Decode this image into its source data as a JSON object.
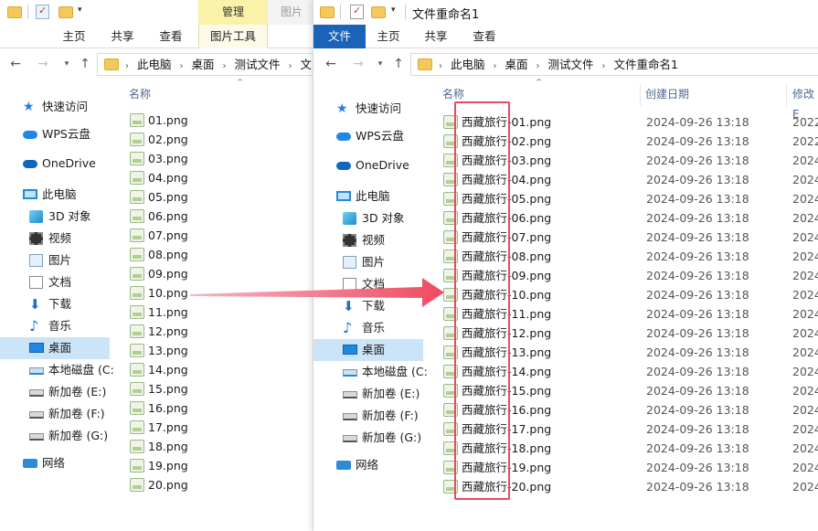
{
  "left_window": {
    "ribbon_context_header": "管理",
    "ribbon_context_header_2": "图片",
    "tabs": [
      "主页",
      "共享",
      "查看",
      "图片工具"
    ],
    "breadcrumbs": [
      "此电脑",
      "桌面",
      "测试文件",
      "文"
    ],
    "column_name": "名称",
    "files": [
      "01.png",
      "02.png",
      "03.png",
      "04.png",
      "05.png",
      "06.png",
      "07.png",
      "08.png",
      "09.png",
      "10.png",
      "11.png",
      "12.png",
      "13.png",
      "14.png",
      "15.png",
      "16.png",
      "17.png",
      "18.png",
      "19.png",
      "20.png"
    ]
  },
  "right_window": {
    "title": "文件重命名1",
    "tabs": [
      "文件",
      "主页",
      "共享",
      "查看"
    ],
    "breadcrumbs": [
      "此电脑",
      "桌面",
      "测试文件",
      "文件重命名1"
    ],
    "columns": {
      "name": "名称",
      "created": "创建日期",
      "modified": "修改E"
    },
    "files": [
      {
        "name": "西藏旅行-01.png",
        "created": "2024-09-26 13:18",
        "modified": "2022"
      },
      {
        "name": "西藏旅行-02.png",
        "created": "2024-09-26 13:18",
        "modified": "2022"
      },
      {
        "name": "西藏旅行-03.png",
        "created": "2024-09-26 13:18",
        "modified": "2024"
      },
      {
        "name": "西藏旅行-04.png",
        "created": "2024-09-26 13:18",
        "modified": "2024"
      },
      {
        "name": "西藏旅行-05.png",
        "created": "2024-09-26 13:18",
        "modified": "2024"
      },
      {
        "name": "西藏旅行-06.png",
        "created": "2024-09-26 13:18",
        "modified": "2024"
      },
      {
        "name": "西藏旅行-07.png",
        "created": "2024-09-26 13:18",
        "modified": "2024"
      },
      {
        "name": "西藏旅行-08.png",
        "created": "2024-09-26 13:18",
        "modified": "2024"
      },
      {
        "name": "西藏旅行-09.png",
        "created": "2024-09-26 13:18",
        "modified": "2024"
      },
      {
        "name": "西藏旅行-10.png",
        "created": "2024-09-26 13:18",
        "modified": "2024"
      },
      {
        "name": "西藏旅行-11.png",
        "created": "2024-09-26 13:18",
        "modified": "2024"
      },
      {
        "name": "西藏旅行-12.png",
        "created": "2024-09-26 13:18",
        "modified": "2024"
      },
      {
        "name": "西藏旅行-13.png",
        "created": "2024-09-26 13:18",
        "modified": "2024"
      },
      {
        "name": "西藏旅行-14.png",
        "created": "2024-09-26 13:18",
        "modified": "2024"
      },
      {
        "name": "西藏旅行-15.png",
        "created": "2024-09-26 13:18",
        "modified": "2024"
      },
      {
        "name": "西藏旅行-16.png",
        "created": "2024-09-26 13:18",
        "modified": "2024"
      },
      {
        "name": "西藏旅行-17.png",
        "created": "2024-09-26 13:18",
        "modified": "2024"
      },
      {
        "name": "西藏旅行-18.png",
        "created": "2024-09-26 13:18",
        "modified": "2024"
      },
      {
        "name": "西藏旅行-19.png",
        "created": "2024-09-26 13:18",
        "modified": "2024"
      },
      {
        "name": "西藏旅行-20.png",
        "created": "2024-09-26 13:18",
        "modified": "2024"
      }
    ]
  },
  "nav_pane": [
    {
      "label": "快速访问",
      "icon": "star-icon"
    },
    {
      "label": "WPS云盘",
      "icon": "cloud-icon"
    },
    {
      "label": "OneDrive",
      "icon": "onedrive-icon"
    },
    {
      "label": "此电脑",
      "icon": "computer-icon"
    },
    {
      "label": "3D 对象",
      "icon": "3d-objects-icon"
    },
    {
      "label": "视频",
      "icon": "video-icon"
    },
    {
      "label": "图片",
      "icon": "pictures-icon"
    },
    {
      "label": "文档",
      "icon": "documents-icon"
    },
    {
      "label": "下载",
      "icon": "download-icon"
    },
    {
      "label": "音乐",
      "icon": "music-icon"
    },
    {
      "label": "桌面",
      "icon": "desktop-icon",
      "selected": true
    },
    {
      "label": "本地磁盘 (C:",
      "icon": "system-drive-icon"
    },
    {
      "label": "新加卷 (E:)",
      "icon": "drive-icon"
    },
    {
      "label": "新加卷 (F:)",
      "icon": "drive-icon"
    },
    {
      "label": "新加卷 (G:)",
      "icon": "drive-icon"
    },
    {
      "label": "网络",
      "icon": "network-icon"
    }
  ],
  "colors": {
    "file_tab": "#1a63b8",
    "selection": "#cce4f7",
    "annotation": "#ea4a5f"
  }
}
